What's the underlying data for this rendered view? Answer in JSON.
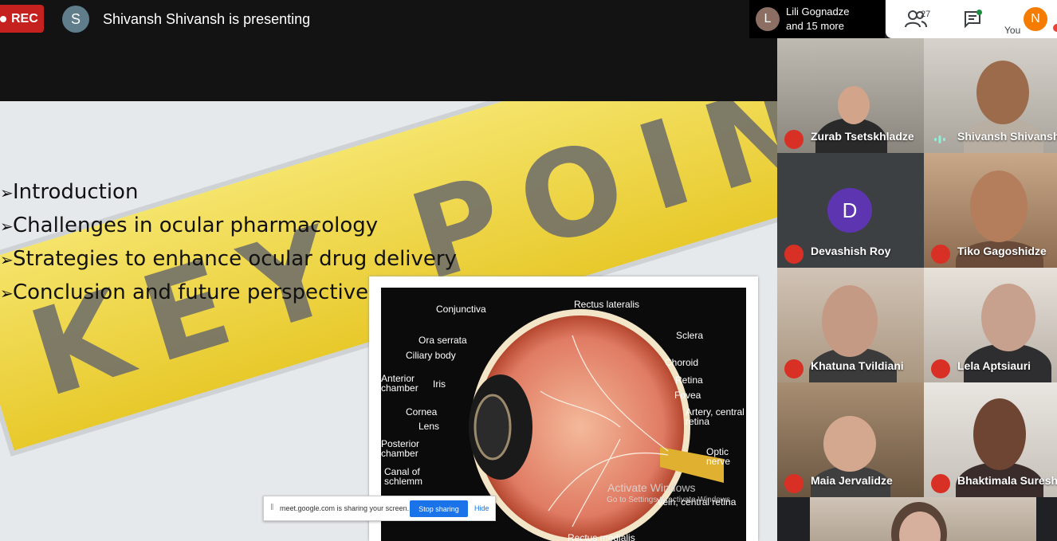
{
  "recording": {
    "label": "REC"
  },
  "presenter": {
    "initial": "S",
    "text": "Shivansh Shivansh is presenting"
  },
  "slide": {
    "bullets": [
      "Introduction",
      "Challenges in ocular pharmacology",
      "Strategies to enhance ocular drug delivery",
      "Conclusion and future perspectives"
    ],
    "background_sign_text": "KEY POINTS",
    "eye_labels": [
      "Conjunctiva",
      "Rectus lateralis",
      "Ora serrata",
      "Sclera",
      "Ciliary body",
      "Choroid",
      "Anterior chamber",
      "Iris",
      "Retina",
      "Fovea",
      "Cornea",
      "Lens",
      "Artery, central retina",
      "Posterior chamber",
      "Optic nerve",
      "Canal of schlemm",
      "Vein, central retina",
      "Rectus medialis"
    ]
  },
  "share_bar": {
    "text": "meet.google.com is sharing your screen.",
    "stop_label": "Stop sharing",
    "hide_label": "Hide"
  },
  "watermark": {
    "line1": "Activate Windows",
    "line2": "Go to Settings to activate Windows."
  },
  "join_chip": {
    "initial": "L",
    "line1": "Lili Gognadze",
    "line2": "and 15 more"
  },
  "top_panel": {
    "participant_count": "27",
    "you_initial": "N",
    "you_label": "You"
  },
  "participants": [
    {
      "name": "Zurab Tsetskhladze",
      "muted": true
    },
    {
      "name": "Shivansh Shivansh",
      "muted": false,
      "speaking": true
    },
    {
      "name": "Devashish Roy",
      "muted": true,
      "initial": "D"
    },
    {
      "name": "Tiko Gagoshidze",
      "muted": true
    },
    {
      "name": "Khatuna Tvildiani",
      "muted": true
    },
    {
      "name": "Lela Aptsiauri",
      "muted": true
    },
    {
      "name": "Maia Jervalidze",
      "muted": true
    },
    {
      "name": "Bhaktimala Suresh",
      "muted": true
    }
  ],
  "colors": {
    "rec": "#c5221f",
    "mute": "#d93025",
    "accent": "#1a73e8",
    "you_avatar": "#f57c00",
    "devashish_avatar": "#5e35b1"
  }
}
